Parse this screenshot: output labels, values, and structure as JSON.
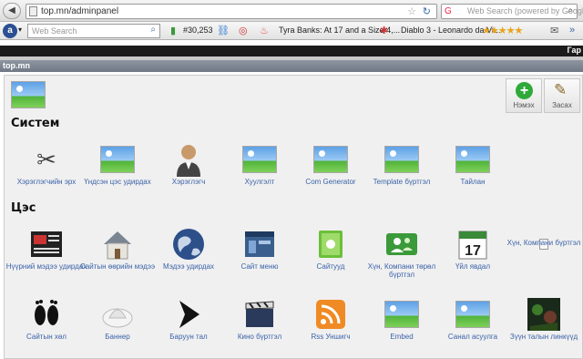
{
  "browser": {
    "url": "top.mn/adminpanel",
    "search_placeholder": "Web Search (powered by Google)"
  },
  "toolbar": {
    "search_placeholder": "Web Search",
    "rank": "#30,253",
    "news1": "Tyra Banks: At 17 and a Size 4,...",
    "news2": "Diablo 3 - Leonardo da Vi...",
    "stars": "★★★★★",
    "right_label": "Гар"
  },
  "app": {
    "title": "top.mn",
    "add_label": "Нэмэх",
    "edit_label": "Засах"
  },
  "sections": {
    "system": "Систем",
    "menu": "Цэс"
  },
  "system_items": [
    {
      "label": "Хэрэглэгчийн эрх",
      "icon": "tools-icon"
    },
    {
      "label": "Үндсэн цэс удирдах",
      "icon": "image-placeholder-icon"
    },
    {
      "label": "Хэрэглэгч",
      "icon": "user-icon"
    },
    {
      "label": "Хуулгэлт",
      "icon": "image-placeholder-icon"
    },
    {
      "label": "Com Generator",
      "icon": "image-placeholder-icon"
    },
    {
      "label": "Template бүртгэл",
      "icon": "image-placeholder-icon"
    },
    {
      "label": "Тайлан",
      "icon": "image-placeholder-icon"
    }
  ],
  "menu_row1": [
    {
      "label": "Нүүрний мэдээ удирдах",
      "icon": "news-icon"
    },
    {
      "label": "Сайтын өөрийн мэдээ",
      "icon": "house-icon"
    },
    {
      "label": "Мэдээ удирдах",
      "icon": "globe-icon"
    },
    {
      "label": "Сайт меню",
      "icon": "window-icon"
    },
    {
      "label": "Сайтууд",
      "icon": "book-icon"
    },
    {
      "label": "Хүн, Компани төрөл бүртгэл",
      "icon": "people-icon"
    },
    {
      "label": "Үйл явдал",
      "icon": "calendar-icon"
    },
    {
      "label": "Хүн, Компани бүртгэл",
      "icon": "file-icon"
    }
  ],
  "menu_row2": [
    {
      "label": "Сайтын хөл",
      "icon": "footprints-icon"
    },
    {
      "label": "Баннер",
      "icon": "banner-icon"
    },
    {
      "label": "Баруун тал",
      "icon": "arrow-right-icon"
    },
    {
      "label": "Кино бүртгэл",
      "icon": "film-icon"
    },
    {
      "label": "Rss Уншигч",
      "icon": "rss-icon"
    },
    {
      "label": "Embed",
      "icon": "image-placeholder-icon"
    },
    {
      "label": "Санал асуулга",
      "icon": "image-placeholder-icon"
    },
    {
      "label": "Зүүн талын линкүүд",
      "icon": "game-icon"
    }
  ],
  "calendar_day": "17"
}
